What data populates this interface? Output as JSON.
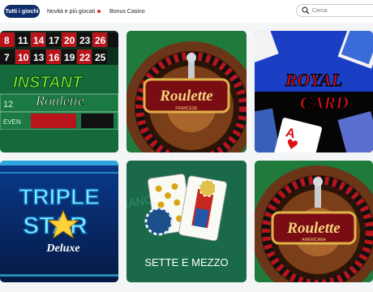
{
  "nav": {
    "tabs": [
      {
        "label": "Tutti i giochi",
        "active": true
      },
      {
        "label": "Novità e più giocati",
        "badge_color": "#d9262c"
      },
      {
        "label": "Bonus Casino"
      }
    ]
  },
  "search": {
    "placeholder": "Cerca",
    "icon": "search-icon"
  },
  "games": [
    {
      "title_line1": "INSTANT",
      "title_line2": "Roulette",
      "numbers": [
        "8",
        "11",
        "14",
        "17",
        "20",
        "23",
        "26"
      ],
      "numbers2": [
        "7",
        "10",
        "13",
        "16",
        "19",
        "22",
        "25"
      ],
      "label_even": "EVEN",
      "label_12": "12"
    },
    {
      "title": "Roulette",
      "subtitle": "FRANCESE"
    },
    {
      "title_line1": "ROYAL",
      "title_line2": "CARD",
      "card_rank": "A"
    },
    {
      "title_line1": "TRIPLE",
      "title_line2": "STAR",
      "title_line3": "Deluxe"
    },
    {
      "title": "SETTE E MEZZO",
      "bg_text": "BANCO"
    },
    {
      "title": "Roulette",
      "subtitle": "AMERICANA"
    }
  ]
}
